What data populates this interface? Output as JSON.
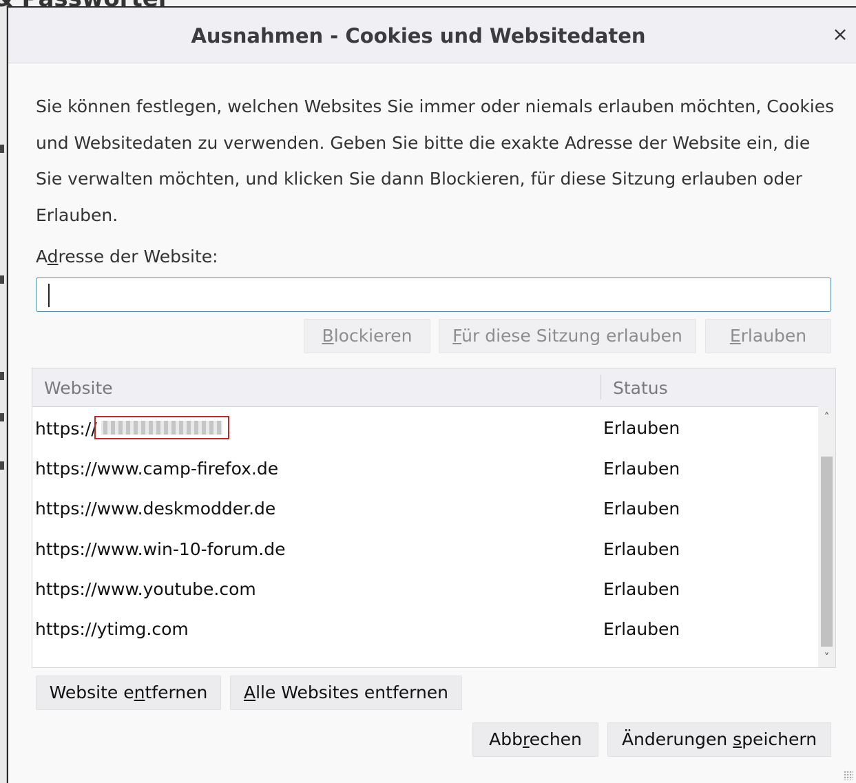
{
  "background": {
    "heading": "& Passwörter"
  },
  "dialog": {
    "title": "Ausnahmen - Cookies und Websitedaten",
    "close_symbol": "×",
    "description": "Sie können festlegen, welchen Websites Sie immer oder niemals erlauben möchten, Cookies und Websitedaten zu verwenden. Geben Sie bitte die exakte Adresse der Website ein, die Sie verwalten möchten, und klicken Sie dann Blockieren, für diese Sitzung erlauben oder Erlauben.",
    "address_label": {
      "pre": "A",
      "key": "d",
      "post": "resse der Website:"
    },
    "address_input": {
      "value": "",
      "placeholder": ""
    },
    "buttons": {
      "block": {
        "key": "B",
        "rest": "lockieren"
      },
      "session": {
        "key": "F",
        "rest": "ür diese Sitzung erlauben"
      },
      "allow": {
        "key": "E",
        "rest": "rlauben"
      }
    },
    "table": {
      "columns": {
        "website": "Website",
        "status": "Status"
      },
      "rows": [
        {
          "website": "https://",
          "status": "Erlauben",
          "redacted": true
        },
        {
          "website": "https://www.camp-firefox.de",
          "status": "Erlauben"
        },
        {
          "website": "https://www.deskmodder.de",
          "status": "Erlauben"
        },
        {
          "website": "https://www.win-10-forum.de",
          "status": "Erlauben"
        },
        {
          "website": "https://www.youtube.com",
          "status": "Erlauben"
        },
        {
          "website": "https://ytimg.com",
          "status": "Erlauben"
        }
      ]
    },
    "remove_site": {
      "pre": "Website e",
      "key": "n",
      "post": "tfernen"
    },
    "remove_all": {
      "pre": "",
      "key": "A",
      "post": "lle Websites entfernen"
    },
    "cancel": {
      "pre": "Abb",
      "key": "r",
      "post": "echen"
    },
    "save": {
      "pre": "Änderungen ",
      "key": "s",
      "post": "peichern"
    }
  }
}
